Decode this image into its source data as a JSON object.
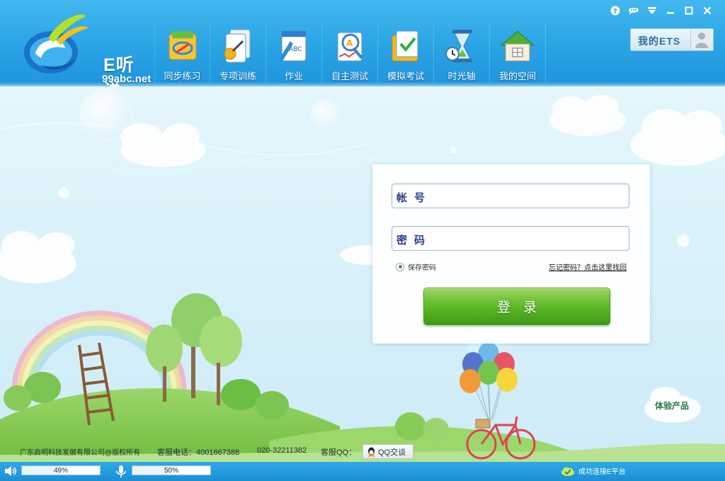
{
  "app": {
    "logo_title": "E听说",
    "logo_url": "99abc.net"
  },
  "nav": {
    "items": [
      {
        "label": "同步练习",
        "icon": "sync-practice-icon"
      },
      {
        "label": "专项训练",
        "icon": "special-training-icon"
      },
      {
        "label": "作业",
        "icon": "homework-icon"
      },
      {
        "label": "自主测试",
        "icon": "self-test-icon"
      },
      {
        "label": "模拟考试",
        "icon": "mock-exam-icon"
      },
      {
        "label": "时光轴",
        "icon": "timeline-icon"
      },
      {
        "label": "我的空间",
        "icon": "my-space-icon"
      }
    ]
  },
  "window_controls": [
    "help-icon",
    "chat-icon",
    "dropdown-icon",
    "minimize-icon",
    "maximize-icon",
    "close-icon"
  ],
  "my_ets": {
    "label": "我的ETS"
  },
  "login": {
    "account_label": "帐号",
    "account_value": "",
    "password_label": "密码",
    "password_value": "",
    "save_password_label": "保存密码",
    "save_password_checked": false,
    "forgot_link": "忘记密码？点击这里找回",
    "submit_label": "登录"
  },
  "trial": {
    "label": "体验产品"
  },
  "footer": {
    "copyright": "广东启明科技发展有限公司@版权所有",
    "phone_label": "客服电话：4001667388",
    "phone2": "020-32211382",
    "qq_label": "客服QQ：",
    "qq_button": "QQ交谈"
  },
  "status": {
    "volume_percent": "49%",
    "volume_value": 0.49,
    "mic_percent": "50%",
    "mic_value": 0.5,
    "connection_text": "成功连接E平台"
  },
  "colors": {
    "header_blue": "#2aa3e5",
    "login_green": "#64bb2b",
    "sky": "#dff3fb",
    "grass": "#8cd05a"
  }
}
